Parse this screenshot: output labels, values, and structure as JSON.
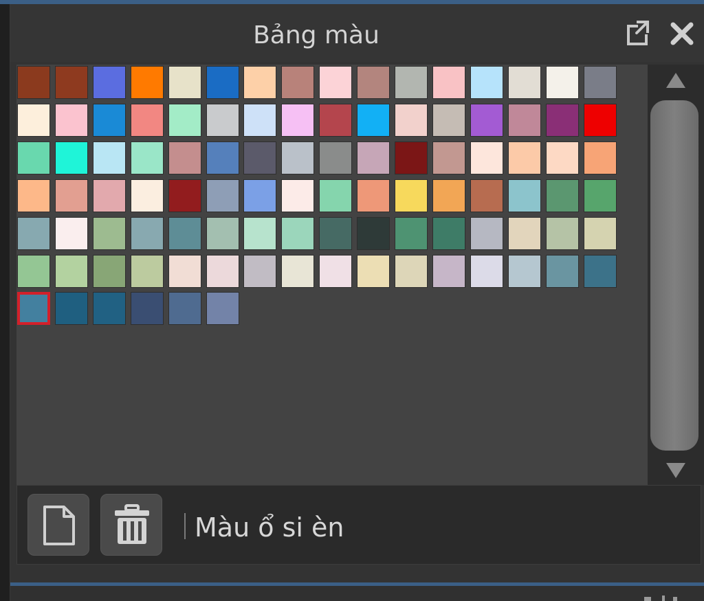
{
  "panel": {
    "title": "Bảng màu",
    "detach_icon": "external-link-icon",
    "close_icon": "close-x-icon"
  },
  "swatches": [
    [
      "#8b3a1e",
      "#8e3a1f",
      "#5b6de0",
      "#ff7a00",
      "#e7e2c9",
      "#1a6cc4",
      "#fdd0a8",
      "#b8827a",
      "#fcd3d7",
      "#b3857e",
      "#b2b6b0",
      "#f9c2c5",
      "#b6e3fb",
      "#e2ddd4",
      "#f4f1ea",
      "#7a7d88"
    ],
    [
      "#fdefdc",
      "#fbc3cf",
      "#1a8ad6",
      "#f28782",
      "#a3ecc7",
      "#c9cbcd",
      "#cee1f8",
      "#f6c0f4",
      "#b4454d",
      "#12b0f5",
      "#f2d1cc",
      "#c5bcb4",
      "#a35bd3",
      "#c08899",
      "#8a2f76",
      "#ee0000"
    ],
    [
      "#69d8ae",
      "#1ff4d8",
      "#b9e6f4",
      "#9ae6c8",
      "#c48e8e",
      "#5580bb",
      "#5b5a6a",
      "#bac1c9",
      "#8a8c8b",
      "#c6a6b7",
      "#7b1616",
      "#c29891",
      "#fde6dc",
      "#fccaa8",
      "#fdd9c4",
      "#f7a476"
    ],
    [
      "#fdb889",
      "#e29f91",
      "#e2a9ad",
      "#fbeee0",
      "#921c1e",
      "#8e9eb6",
      "#7ba0e6",
      "#fcebe8",
      "#85d5ad",
      "#ee9878",
      "#f7d95c",
      "#f2a655",
      "#b76c50",
      "#8cc4cc",
      "#5b9770",
      "#57a56c"
    ],
    [
      "#87a9b0",
      "#faeeee",
      "#9dbb90",
      "#88a9b0",
      "#5e8d96",
      "#a3bfb0",
      "#b7e3cd",
      "#9bd6bb",
      "#466a64",
      "#2e3a38",
      "#4e9372",
      "#3e7c67",
      "#b6b8c2",
      "#e2d5bc",
      "#b5c3a6",
      "#d5d3b0"
    ],
    [
      "#94c694",
      "#b3d2a0",
      "#88a676",
      "#bccb9f",
      "#f1ddd5",
      "#ecd9db",
      "#c1bcc4",
      "#e8e5d6",
      "#f0e0e6",
      "#ecdeb4",
      "#ddd6b8",
      "#c6b6c8",
      "#dcdbe8",
      "#b5c7d0",
      "#6a95a1",
      "#3c7289"
    ],
    [
      "#43809f",
      "#1f5f80",
      "#216183",
      "#3a4e72",
      "#4f6b90",
      "#7383a8"
    ]
  ],
  "selected_swatch": {
    "row": 6,
    "col": 0
  },
  "scrollbar": {
    "up_icon": "triangle-up-icon",
    "down_icon": "triangle-down-icon"
  },
  "footer": {
    "new_icon": "new-document-icon",
    "delete_icon": "trash-icon",
    "color_name": "Màu ổ si èn"
  }
}
